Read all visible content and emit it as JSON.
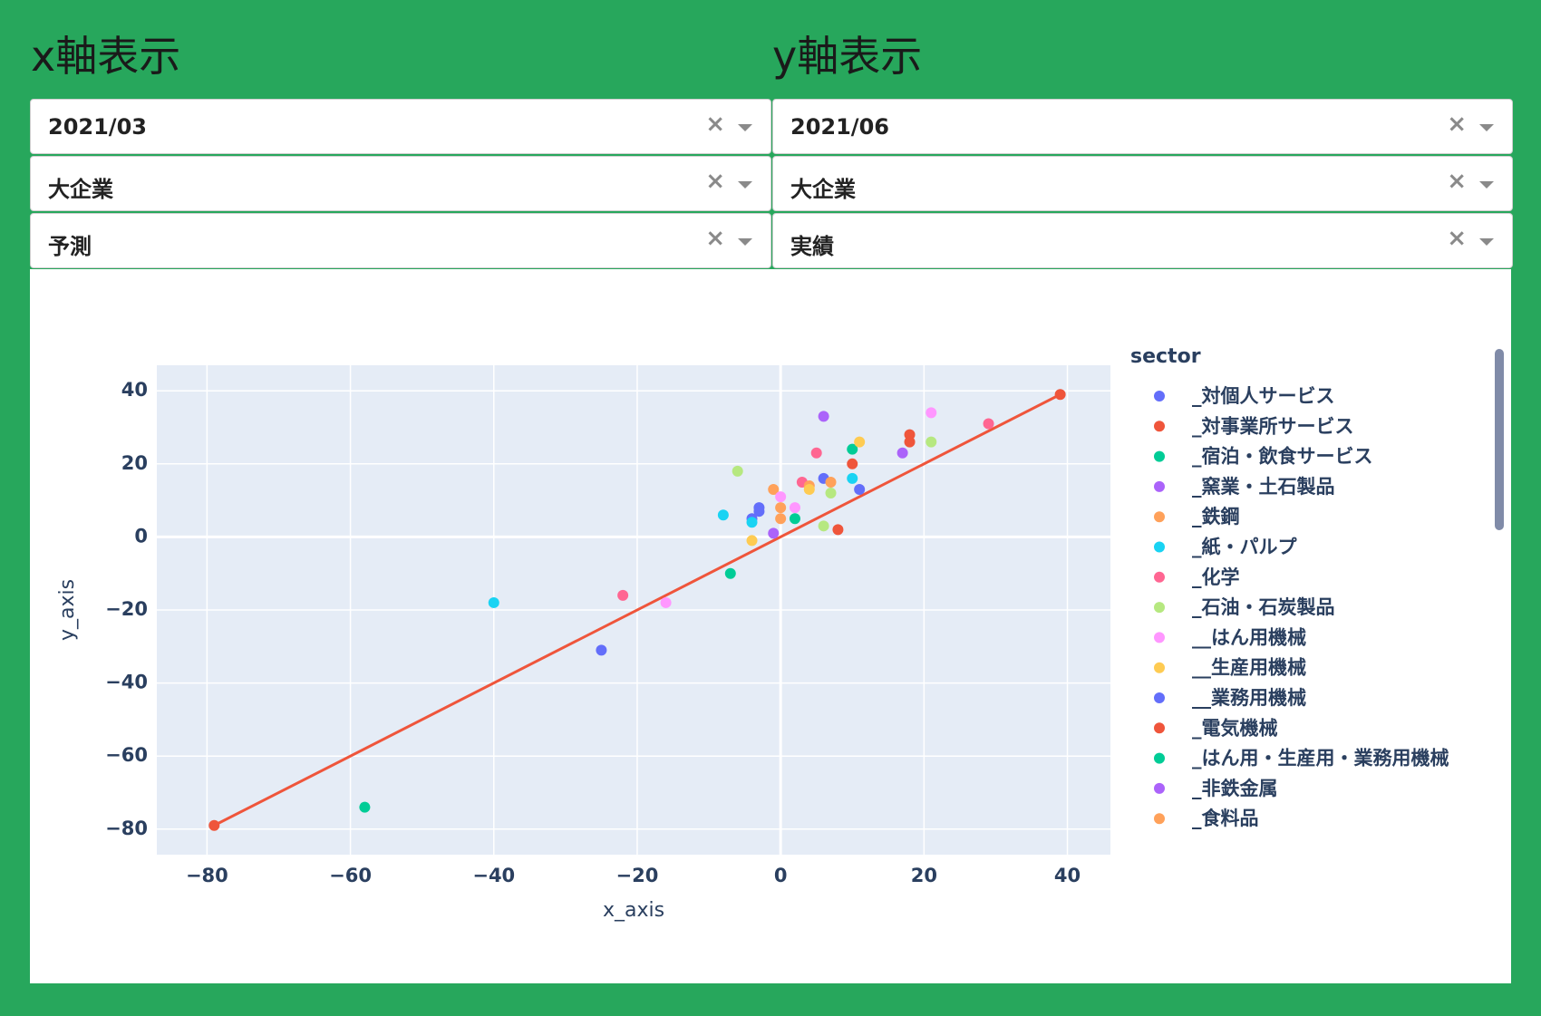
{
  "columns": {
    "x": {
      "title": "x軸表示",
      "date": {
        "value": "2021/03"
      },
      "size": {
        "value": "大企業"
      },
      "kind": {
        "value": "予測"
      }
    },
    "y": {
      "title": "y軸表示",
      "date": {
        "value": "2021/06"
      },
      "size": {
        "value": "大企業"
      },
      "kind": {
        "value": "実績"
      }
    },
    "clear_glyph": "×"
  },
  "chart_data": {
    "type": "scatter",
    "xlabel": "x_axis",
    "ylabel": "y_axis",
    "xlim": [
      -87,
      46
    ],
    "ylim": [
      -87,
      47
    ],
    "xticks": [
      -80,
      -60,
      -40,
      -20,
      0,
      20,
      40
    ],
    "yticks": [
      -80,
      -60,
      -40,
      -20,
      0,
      20,
      40
    ],
    "xtick_labels": [
      "−80",
      "−60",
      "−40",
      "−20",
      "0",
      "20",
      "40"
    ],
    "ytick_labels": [
      "−80",
      "−60",
      "−40",
      "−20",
      "0",
      "20",
      "40"
    ],
    "grid": true,
    "plot_bg": "#e5ecf6",
    "legend": {
      "title": "sector",
      "placement": "right",
      "items": [
        {
          "name": "_対個人サービス",
          "color": "#636efa"
        },
        {
          "name": "_対事業所サービス",
          "color": "#ef553b"
        },
        {
          "name": "_宿泊・飲食サービス",
          "color": "#00cc96"
        },
        {
          "name": "_窯業・土石製品",
          "color": "#ab63fa"
        },
        {
          "name": "_鉄鋼",
          "color": "#ffa15a"
        },
        {
          "name": "_紙・パルプ",
          "color": "#19d3f3"
        },
        {
          "name": "_化学",
          "color": "#ff6692"
        },
        {
          "name": "_石油・石炭製品",
          "color": "#b6e880"
        },
        {
          "name": "__はん用機械",
          "color": "#ff97ff"
        },
        {
          "name": "__生産用機械",
          "color": "#fecb52"
        },
        {
          "name": "__業務用機械",
          "color": "#636efa"
        },
        {
          "name": "_電気機械",
          "color": "#ef553b"
        },
        {
          "name": "_はん用・生産用・業務用機械",
          "color": "#00cc96"
        },
        {
          "name": "_非鉄金属",
          "color": "#ab63fa"
        },
        {
          "name": "_食料品",
          "color": "#ffa15a"
        }
      ]
    },
    "fit_line": {
      "color": "#ef553b",
      "x": [
        -79,
        39
      ],
      "y": [
        -79,
        39
      ]
    },
    "points": [
      {
        "x": -58,
        "y": -74,
        "color": "#00cc96"
      },
      {
        "x": -40,
        "y": -18,
        "color": "#19d3f3"
      },
      {
        "x": -25,
        "y": -31,
        "color": "#636efa"
      },
      {
        "x": -22,
        "y": -16,
        "color": "#ff6692"
      },
      {
        "x": -16,
        "y": -18,
        "color": "#ff97ff"
      },
      {
        "x": -8,
        "y": 6,
        "color": "#19d3f3"
      },
      {
        "x": -7,
        "y": -10,
        "color": "#00cc96"
      },
      {
        "x": -6,
        "y": 18,
        "color": "#b6e880"
      },
      {
        "x": -4,
        "y": 5,
        "color": "#636efa"
      },
      {
        "x": -4,
        "y": 4,
        "color": "#19d3f3"
      },
      {
        "x": -4,
        "y": -1,
        "color": "#fecb52"
      },
      {
        "x": -3,
        "y": 8,
        "color": "#636efa"
      },
      {
        "x": -3,
        "y": 7,
        "color": "#636efa"
      },
      {
        "x": -1,
        "y": 13,
        "color": "#ffa15a"
      },
      {
        "x": -1,
        "y": 1,
        "color": "#ab63fa"
      },
      {
        "x": 0,
        "y": 11,
        "color": "#ff97ff"
      },
      {
        "x": 0,
        "y": 8,
        "color": "#ffa15a"
      },
      {
        "x": 0,
        "y": 5,
        "color": "#ffa15a"
      },
      {
        "x": 2,
        "y": 8,
        "color": "#ff97ff"
      },
      {
        "x": 2,
        "y": 5,
        "color": "#00cc96"
      },
      {
        "x": 3,
        "y": 15,
        "color": "#ff6692"
      },
      {
        "x": 4,
        "y": 14,
        "color": "#ffa15a"
      },
      {
        "x": 4,
        "y": 13,
        "color": "#fecb52"
      },
      {
        "x": 5,
        "y": 23,
        "color": "#ff6692"
      },
      {
        "x": 6,
        "y": 33,
        "color": "#ab63fa"
      },
      {
        "x": 6,
        "y": 16,
        "color": "#636efa"
      },
      {
        "x": 6,
        "y": 3,
        "color": "#b6e880"
      },
      {
        "x": 7,
        "y": 15,
        "color": "#ffa15a"
      },
      {
        "x": 7,
        "y": 12,
        "color": "#b6e880"
      },
      {
        "x": 8,
        "y": 2,
        "color": "#ef553b"
      },
      {
        "x": 10,
        "y": 24,
        "color": "#00cc96"
      },
      {
        "x": 10,
        "y": 20,
        "color": "#ef553b"
      },
      {
        "x": 10,
        "y": 16,
        "color": "#19d3f3"
      },
      {
        "x": 11,
        "y": 26,
        "color": "#fecb52"
      },
      {
        "x": 11,
        "y": 13,
        "color": "#636efa"
      },
      {
        "x": 17,
        "y": 23,
        "color": "#ab63fa"
      },
      {
        "x": 18,
        "y": 28,
        "color": "#ef553b"
      },
      {
        "x": 18,
        "y": 26,
        "color": "#ef553b"
      },
      {
        "x": 21,
        "y": 34,
        "color": "#ff97ff"
      },
      {
        "x": 21,
        "y": 26,
        "color": "#b6e880"
      },
      {
        "x": 29,
        "y": 31,
        "color": "#ff6692"
      },
      {
        "x": 39,
        "y": 39,
        "color": "#ef553b"
      },
      {
        "x": -79,
        "y": -79,
        "color": "#ef553b"
      }
    ]
  }
}
